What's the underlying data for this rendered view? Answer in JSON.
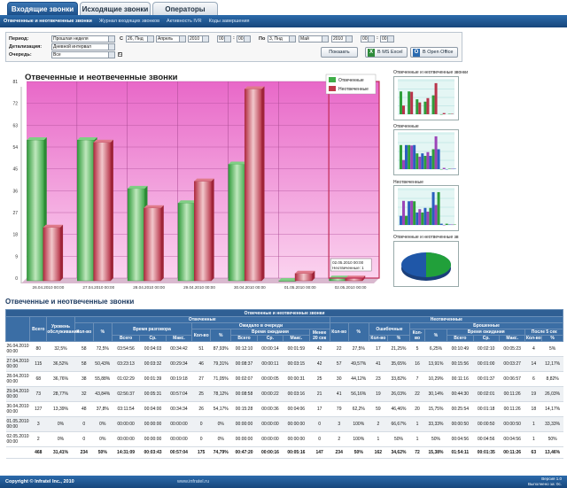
{
  "tabs": [
    {
      "label": "Входящие звонки",
      "active": true
    },
    {
      "label": "Исходящие звонки",
      "active": false
    },
    {
      "label": "Операторы",
      "active": false
    }
  ],
  "subnav": [
    "Отвеченные и неотвеченные звонки",
    "Журнал входящих звонков",
    "Активность IVR",
    "Коды завершения"
  ],
  "filters": {
    "period_label": "Период:",
    "period_value": "Прошлая неделя",
    "from_label": "С",
    "from_day": "26, Пнд",
    "from_month": "Апрель",
    "from_year": "2010",
    "from_hour": "00",
    "from_min": "00",
    "to_label": "По",
    "to_day": "3, Пнд",
    "to_month": "Май",
    "to_year": "2010",
    "to_hour": "00",
    "to_min": "00",
    "detail_label": "Детализация:",
    "detail_value": "Дневной интервал",
    "queue_label": "Очередь:",
    "queue_value": "Все",
    "queue_suffix": "с.",
    "show_button": "Показать",
    "excel_button": "В MS Excel",
    "office_button": "В Open Office"
  },
  "chart_title": "Отвеченные и неотвеченные звонки",
  "chart_data": {
    "type": "bar",
    "categories": [
      "26.04.2010 00:00",
      "27.04.2010 00:00",
      "28.04.2010 00:00",
      "29.04.2010 00:00",
      "30.04.2010 00:00",
      "01.05.2010 00:00",
      "02.05.2010 00:00"
    ],
    "series": [
      {
        "name": "Отвеченные",
        "values": [
          58,
          58,
          38,
          32,
          48,
          0,
          1
        ],
        "color": "#3fae48"
      },
      {
        "name": "Неотвеченные",
        "values": [
          22,
          57,
          30,
          41,
          79,
          3,
          1
        ],
        "color": "#c0394c"
      }
    ],
    "ylim": [
      0,
      81
    ],
    "yticks": [
      0,
      9,
      18,
      27,
      36,
      45,
      54,
      63,
      72,
      81
    ],
    "legend": "top-right",
    "grid": true,
    "tooltip": "02.05.2010 00:00 Неотвеченные: 1"
  },
  "thumbnails": [
    {
      "caption": "Отвеченные и неотвеченные звонки"
    },
    {
      "caption": "Отвеченные"
    },
    {
      "caption": "Неотвеченные"
    },
    {
      "caption": "Отвеченные и неотвеченные зв"
    }
  ],
  "table": {
    "title": "Отвеченные и неотвеченные звонки",
    "top_header": "Отвеченные и неотвеченные звонки",
    "h": {
      "total": "Всего",
      "level": "Уровень обслуживания",
      "answered": "Отвеченные",
      "unanswered": "Неотвеченные",
      "count": "Кол-во",
      "pct": "%",
      "talk_time": "Время разговора",
      "waited": "Ожидало в очереди",
      "wait_time": "Время ожидания",
      "less20": "Менее 20 сек",
      "errors": "Ошибочные",
      "abandoned": "Брошенные",
      "after5": "После 5 сек",
      "sum": "Всего",
      "avg": "Ср.",
      "max": "Макс."
    },
    "rows": [
      [
        "26.04.2010 00:00",
        "80",
        "32,5%",
        "58",
        "72,5%",
        "03:54:56",
        "00:04:03",
        "00:34:42",
        "51",
        "87,93%",
        "00:12:10",
        "00:00:14",
        "00:01:59",
        "42",
        "22",
        "27,5%",
        "17",
        "21,25%",
        "5",
        "6,25%",
        "00:10:49",
        "00:02:10",
        "00:05:23",
        "4",
        "5%"
      ],
      [
        "27.04.2010 00:00",
        "115",
        "36,52%",
        "58",
        "50,43%",
        "03:23:13",
        "00:03:32",
        "00:29:34",
        "46",
        "79,31%",
        "00:08:37",
        "00:00:11",
        "00:03:15",
        "42",
        "57",
        "49,57%",
        "41",
        "35,65%",
        "16",
        "13,91%",
        "00:15:56",
        "00:01:00",
        "00:03:27",
        "14",
        "12,17%"
      ],
      [
        "28.04.2010 00:00",
        "68",
        "36,76%",
        "38",
        "55,88%",
        "01:02:29",
        "00:01:39",
        "00:19:18",
        "27",
        "71,05%",
        "00:02:07",
        "00:00:05",
        "00:00:31",
        "25",
        "30",
        "44,12%",
        "23",
        "33,82%",
        "7",
        "10,29%",
        "00:11:16",
        "00:01:37",
        "00:06:57",
        "6",
        "8,82%"
      ],
      [
        "29.04.2010 00:00",
        "73",
        "28,77%",
        "32",
        "43,84%",
        "02:56:37",
        "00:05:31",
        "00:57:04",
        "25",
        "78,12%",
        "00:08:58",
        "00:00:22",
        "00:03:16",
        "21",
        "41",
        "56,16%",
        "19",
        "26,03%",
        "22",
        "30,14%",
        "00:44:30",
        "00:02:01",
        "00:11:26",
        "19",
        "26,03%"
      ],
      [
        "30.04.2010 00:00",
        "127",
        "13,39%",
        "48",
        "37,8%",
        "03:11:54",
        "00:04:00",
        "00:34:34",
        "26",
        "54,17%",
        "00:15:28",
        "00:00:36",
        "00:04:06",
        "17",
        "79",
        "62,2%",
        "59",
        "46,46%",
        "20",
        "15,75%",
        "00:25:54",
        "00:01:18",
        "00:11:26",
        "18",
        "14,17%"
      ],
      [
        "01.05.2010 00:00",
        "3",
        "0%",
        "0",
        "0%",
        "00:00:00",
        "00:00:00",
        "00:00:00",
        "0",
        "0%",
        "00:00:00",
        "00:00:00",
        "00:00:00",
        "0",
        "3",
        "100%",
        "2",
        "66,67%",
        "1",
        "33,33%",
        "00:00:50",
        "00:00:50",
        "00:00:50",
        "1",
        "33,33%"
      ],
      [
        "02.05.2010 00:00",
        "2",
        "0%",
        "0",
        "0%",
        "00:00:00",
        "00:00:00",
        "00:00:00",
        "0",
        "0%",
        "00:00:00",
        "00:00:00",
        "00:00:00",
        "0",
        "2",
        "100%",
        "1",
        "50%",
        "1",
        "50%",
        "00:04:56",
        "00:04:56",
        "00:04:56",
        "1",
        "50%"
      ]
    ],
    "total": [
      "",
      "468",
      "31,41%",
      "234",
      "50%",
      "14:31:09",
      "00:03:43",
      "00:57:04",
      "175",
      "74,79%",
      "00:47:20",
      "00:00:16",
      "00:05:16",
      "147",
      "234",
      "50%",
      "162",
      "34,62%",
      "72",
      "15,38%",
      "01:54:11",
      "00:01:35",
      "00:11:26",
      "63",
      "13,46%"
    ]
  },
  "footer": {
    "copyright": "Copyright © Infratel Inc., 2010",
    "site": "www.infratel.ru",
    "version": "Версия 1.0",
    "exec": "Выполнено за: 0с."
  }
}
